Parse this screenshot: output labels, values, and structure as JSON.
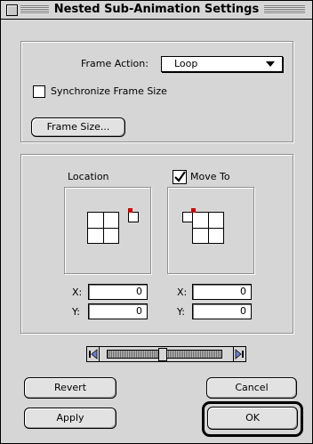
{
  "window": {
    "title": "Nested Sub-Animation Settings"
  },
  "frame": {
    "action_label": "Frame Action:",
    "action_value": "Loop",
    "sync_label": "Synchronize Frame Size",
    "sync_checked": false,
    "frame_size_button": "Frame Size..."
  },
  "location": {
    "label": "Location",
    "x_label": "X:",
    "y_label": "Y:",
    "x": "0",
    "y": "0"
  },
  "moveto": {
    "label": "Move To",
    "checked": true,
    "x_label": "X:",
    "y_label": "Y:",
    "x": "0",
    "y": "0"
  },
  "buttons": {
    "revert": "Revert",
    "cancel": "Cancel",
    "apply": "Apply",
    "ok": "OK"
  },
  "colors": {
    "window_bg": "#d6d6d6",
    "anchor_dot": "#cc0000"
  }
}
